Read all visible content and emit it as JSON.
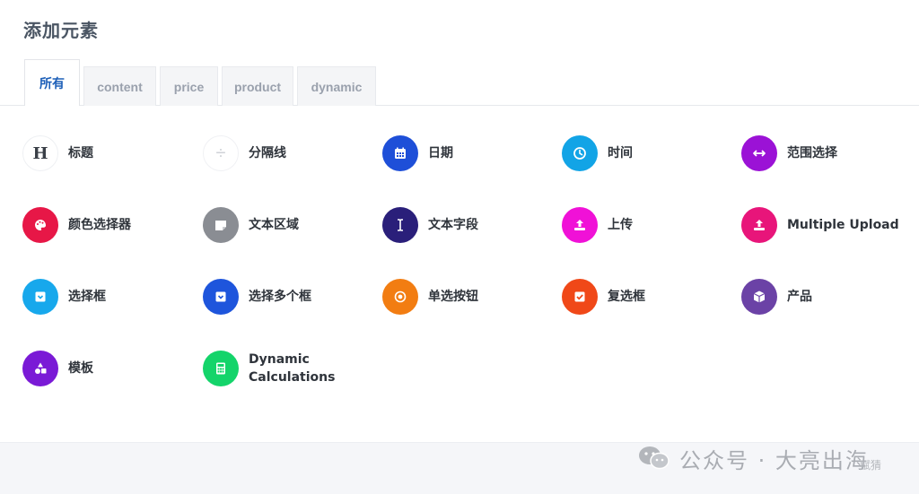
{
  "header": {
    "title": "添加元素"
  },
  "tabs": [
    {
      "label": "所有",
      "active": true
    },
    {
      "label": "content",
      "active": false
    },
    {
      "label": "price",
      "active": false
    },
    {
      "label": "product",
      "active": false
    },
    {
      "label": "dynamic",
      "active": false
    }
  ],
  "elements": [
    {
      "label": "标题",
      "icon": "heading-icon",
      "color": "#ffffff"
    },
    {
      "label": "分隔线",
      "icon": "divider-icon",
      "color": "#ffffff"
    },
    {
      "label": "日期",
      "icon": "calendar-icon",
      "color": "#1e4fd8"
    },
    {
      "label": "时间",
      "icon": "clock-icon",
      "color": "#12a4e6"
    },
    {
      "label": "范围选择",
      "icon": "range-arrows-icon",
      "color": "#9b12d6"
    },
    {
      "label": "颜色选择器",
      "icon": "palette-icon",
      "color": "#e71747"
    },
    {
      "label": "文本区域",
      "icon": "textarea-icon",
      "color": "#8a8d93"
    },
    {
      "label": "文本字段",
      "icon": "text-cursor-icon",
      "color": "#2a1f7a"
    },
    {
      "label": "上传",
      "icon": "upload-icon",
      "color": "#f011d7"
    },
    {
      "label": "Multiple Upload",
      "icon": "upload-icon",
      "color": "#e8157a"
    },
    {
      "label": "选择框",
      "icon": "select-box-icon",
      "color": "#17a8ec"
    },
    {
      "label": "选择多个框",
      "icon": "multi-select-icon",
      "color": "#1e55dc"
    },
    {
      "label": "单选按钮",
      "icon": "radio-button-icon",
      "color": "#f27d12"
    },
    {
      "label": "复选框",
      "icon": "checkbox-icon",
      "color": "#f04818"
    },
    {
      "label": "产品",
      "icon": "product-box-icon",
      "color": "#6b42a6"
    },
    {
      "label": "模板",
      "icon": "template-shapes-icon",
      "color": "#7a1ad6"
    },
    {
      "label": "Dynamic Calculations",
      "icon": "calculator-icon",
      "color": "#14d46a"
    }
  ],
  "watermark": {
    "text": "公众号 · 大亮出海",
    "sub": "赋猜"
  }
}
